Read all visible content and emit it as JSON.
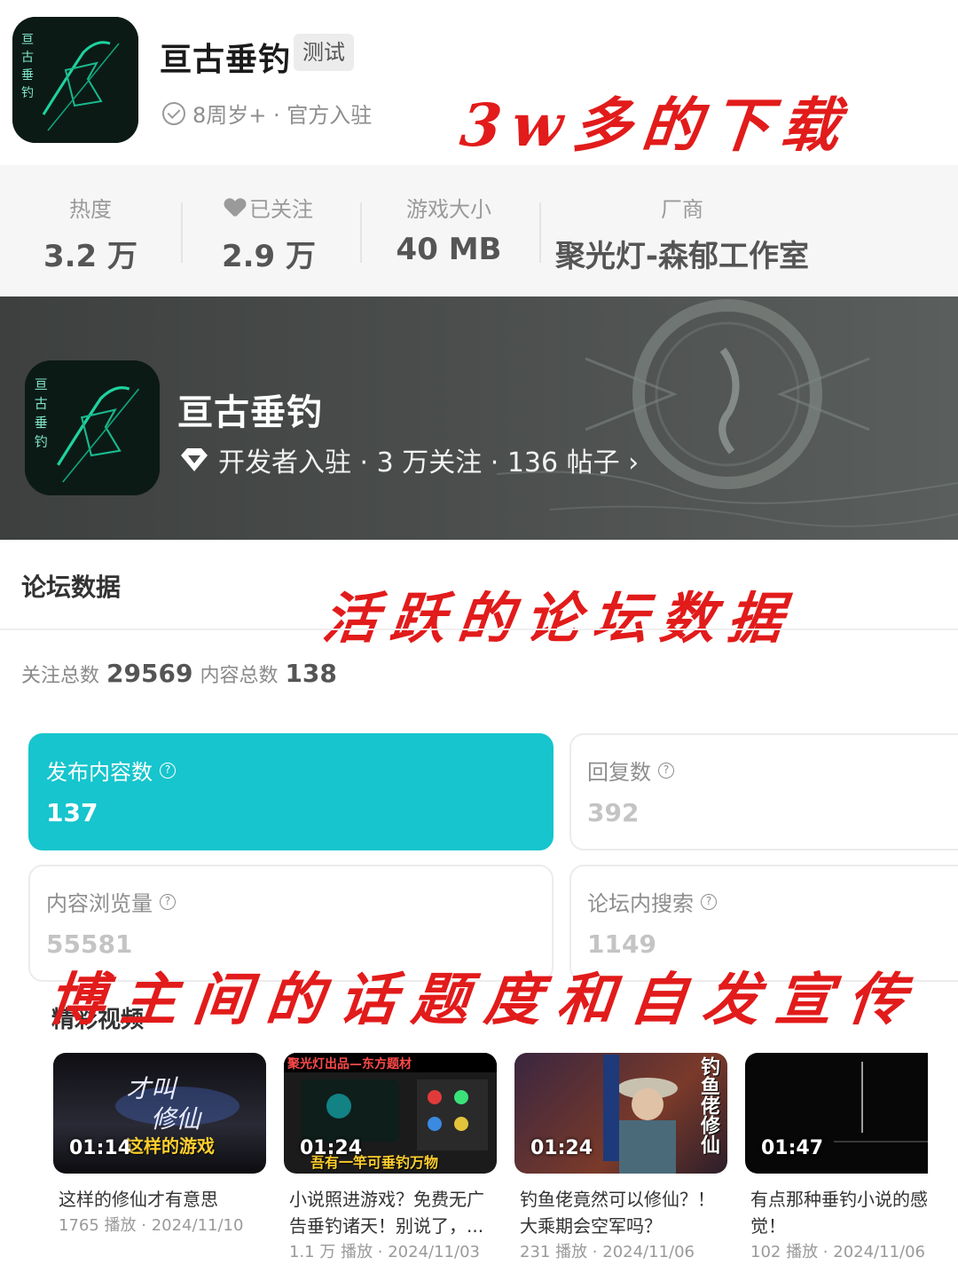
{
  "app": {
    "name": "亘古垂钓",
    "badge": "测试",
    "meta": "8周岁+ · 官方入驻",
    "icon": "game-app-icon"
  },
  "annotations": {
    "downloads": "3w多的下载",
    "forum": "活跃的论坛数据",
    "buzz": "博主间的话题度和自发宣传"
  },
  "stats": [
    {
      "label": "热度",
      "value": "3.2 万"
    },
    {
      "label": "已关注",
      "value": "2.9 万",
      "icon": "heart-icon"
    },
    {
      "label": "游戏大小",
      "value": "40 MB"
    },
    {
      "label": "厂商",
      "value": "聚光灯-森郁工作室"
    }
  ],
  "banner": {
    "title": "亘古垂钓",
    "meta": "开发者入驻 · 3 万关注 · 136 帖子 ›",
    "icon": "diamond-icon"
  },
  "forum": {
    "title": "论坛数据",
    "followers_label": "关注总数",
    "followers": "29569",
    "content_label": "内容总数",
    "content": "138",
    "cards": [
      {
        "label": "发布内容数",
        "value": "137",
        "active": true
      },
      {
        "label": "回复数",
        "value": "392",
        "active": false
      },
      {
        "label": "内容浏览量",
        "value": "55581",
        "active": false
      },
      {
        "label": "论坛内搜索",
        "value": "1149",
        "active": false
      }
    ]
  },
  "videos": {
    "title": "精彩视频",
    "items": [
      {
        "duration": "01:14",
        "overlay": "这样的游戏",
        "title": "这样的修仙才有意思",
        "meta": "1765 播放 · 2024/11/10"
      },
      {
        "duration": "01:24",
        "overlay": "吾有一竿可垂钓万物",
        "overlay_top": "聚光灯出品—东方题材",
        "title": "小说照进游戏？免费无广告垂钓诸天！别说了，...",
        "meta": "1.1 万 播放 · 2024/11/03"
      },
      {
        "duration": "01:24",
        "overlay": "钓鱼佬修仙",
        "title": "钓鱼佬竟然可以修仙？！大乘期会空军吗？",
        "meta": "231 播放 · 2024/11/06"
      },
      {
        "duration": "01:47",
        "overlay": "",
        "title": "有点那种垂钓小说的感觉！",
        "meta": "102 播放 · 2024/11/06"
      }
    ]
  },
  "colors": {
    "accent": "#16c5cd",
    "annotation": "#e21b1b",
    "banner_bg": "#4a4d4c"
  }
}
